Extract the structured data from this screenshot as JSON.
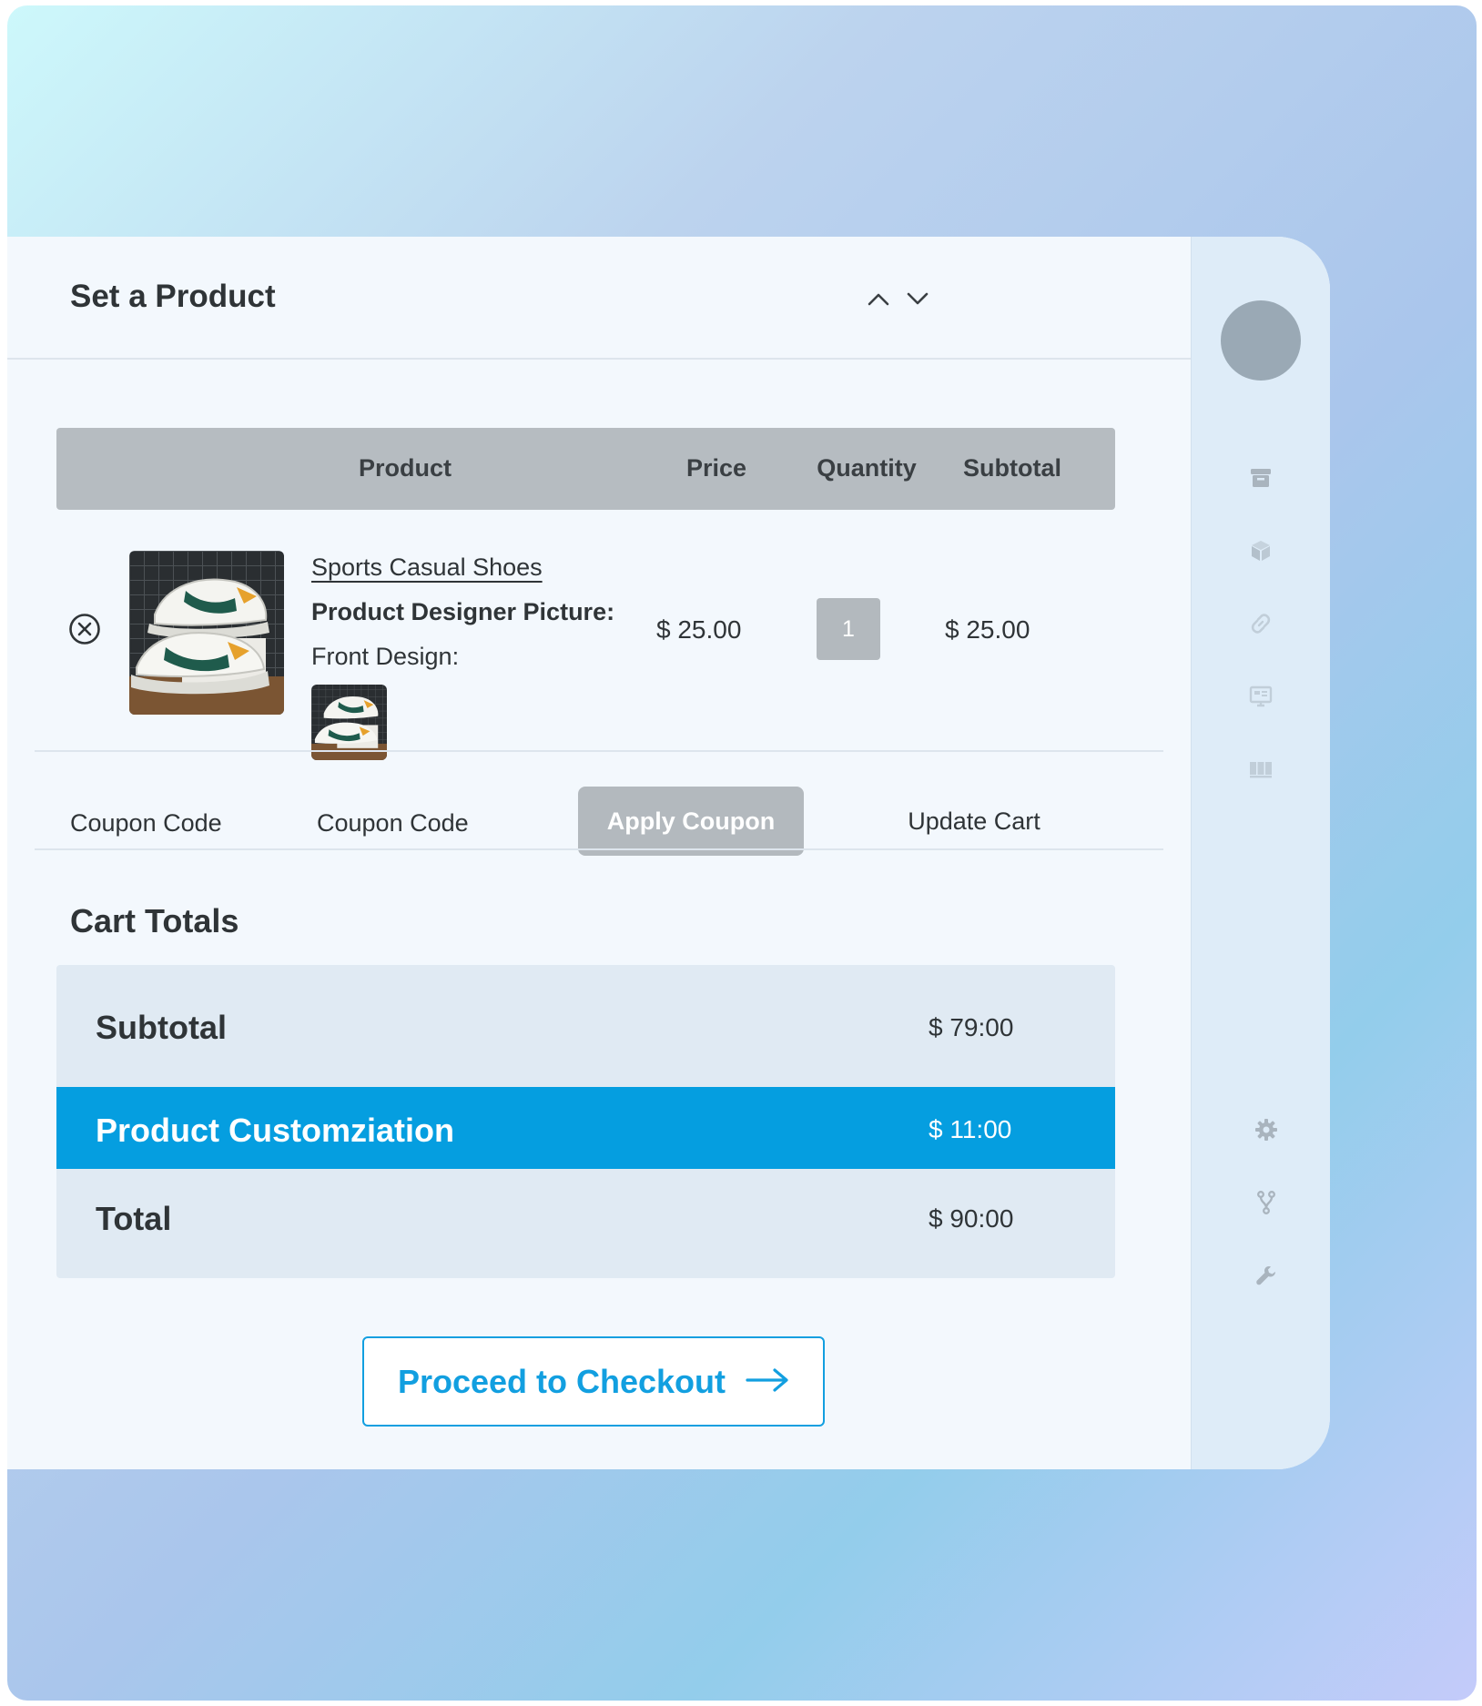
{
  "header": {
    "title": "Set a Product"
  },
  "cart_table": {
    "columns": {
      "product": "Product",
      "price": "Price",
      "quantity": "Quantity",
      "subtotal": "Subtotal"
    },
    "rows": [
      {
        "product_name": "Sports Casual Shoes",
        "designer_label": "Product Designer Picture:",
        "front_label": "Front Design:",
        "price": "$ 25.00",
        "quantity": "1",
        "subtotal": "$ 25.00"
      }
    ]
  },
  "coupon": {
    "label": "Coupon Code",
    "placeholder": "Coupon Code",
    "apply_label": "Apply Coupon",
    "update_label": "Update Cart"
  },
  "totals": {
    "title": "Cart Totals",
    "rows": [
      {
        "label": "Subtotal",
        "value": "$ 79:00"
      },
      {
        "label": "Product Customziation",
        "value": "$ 11:00"
      },
      {
        "label": "Total",
        "value": "$ 90:00"
      }
    ]
  },
  "checkout": {
    "label": "Proceed to Checkout"
  },
  "colors": {
    "accent": "#059ee0",
    "header_bar": "#b6bcc1",
    "disabled_button": "#b3b9be",
    "panel_bg": "#f3f8fd"
  },
  "sidebar_icons": [
    "archive-icon",
    "cube-icon",
    "link-icon",
    "monitor-icon",
    "columns-icon",
    "gear-icon",
    "branch-icon",
    "wrench-icon"
  ]
}
